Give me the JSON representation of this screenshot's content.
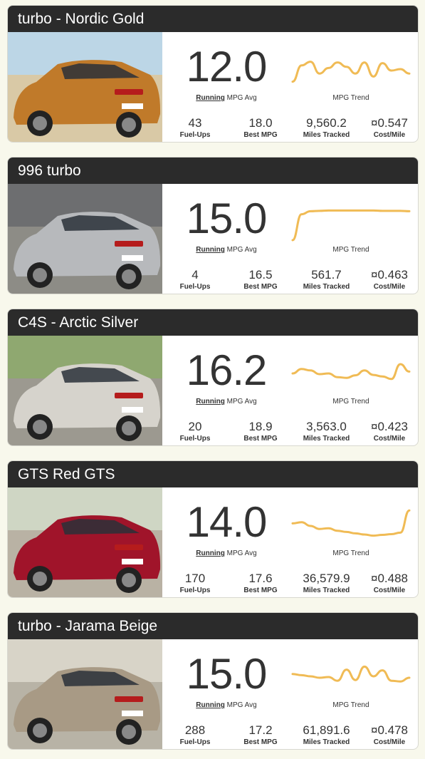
{
  "cars": [
    {
      "name": "turbo - Nordic Gold",
      "mpg": "12.0",
      "running_label": "Running",
      "avg_label": "MPG Avg",
      "trend_label": "MPG Trend",
      "trend": [
        18,
        62,
        72,
        40,
        55,
        70,
        58,
        40,
        70,
        32,
        68,
        48,
        52,
        40
      ],
      "stats": [
        {
          "value": "43",
          "label": "Fuel-Ups"
        },
        {
          "value": "18.0",
          "label": "Best MPG"
        },
        {
          "value": "9,560.2",
          "label": "Miles Tracked"
        },
        {
          "value": "¤0.547",
          "label": "Cost/Mile"
        }
      ],
      "photo": {
        "body": "#c07a2a",
        "sky": "#bcd6e6",
        "ground": "#d9c9a6"
      }
    },
    {
      "name": "996 turbo",
      "mpg": "15.0",
      "running_label": "Running",
      "avg_label": "MPG Avg",
      "trend_label": "MPG Trend",
      "trend": [
        0,
        70,
        78,
        79,
        80,
        80,
        80,
        80,
        80,
        80,
        79,
        79,
        79,
        78
      ],
      "stats": [
        {
          "value": "4",
          "label": "Fuel-Ups"
        },
        {
          "value": "16.5",
          "label": "Best MPG"
        },
        {
          "value": "561.7",
          "label": "Miles Tracked"
        },
        {
          "value": "¤0.463",
          "label": "Cost/Mile"
        }
      ],
      "photo": {
        "body": "#b7b9bc",
        "sky": "#6d6e70",
        "ground": "#8d8c86"
      }
    },
    {
      "name": "C4S - Arctic Silver",
      "mpg": "16.2",
      "running_label": "Running",
      "avg_label": "MPG Avg",
      "trend_label": "MPG Trend",
      "trend": [
        50,
        62,
        58,
        48,
        50,
        40,
        38,
        45,
        58,
        46,
        42,
        35,
        75,
        55
      ],
      "stats": [
        {
          "value": "20",
          "label": "Fuel-Ups"
        },
        {
          "value": "18.9",
          "label": "Best MPG"
        },
        {
          "value": "3,563.0",
          "label": "Miles Tracked"
        },
        {
          "value": "¤0.423",
          "label": "Cost/Mile"
        }
      ],
      "photo": {
        "body": "#d6d3cc",
        "sky": "#8fa870",
        "ground": "#9c9990"
      }
    },
    {
      "name": "GTS Red GTS",
      "mpg": "14.0",
      "running_label": "Running",
      "avg_label": "MPG Avg",
      "trend_label": "MPG Trend",
      "trend": [
        55,
        58,
        48,
        40,
        42,
        35,
        32,
        28,
        25,
        22,
        24,
        26,
        30,
        90
      ],
      "stats": [
        {
          "value": "170",
          "label": "Fuel-Ups"
        },
        {
          "value": "17.6",
          "label": "Best MPG"
        },
        {
          "value": "36,579.9",
          "label": "Miles Tracked"
        },
        {
          "value": "¤0.488",
          "label": "Cost/Mile"
        }
      ],
      "photo": {
        "body": "#a0142a",
        "sky": "#cfd6c4",
        "ground": "#b9b2a4"
      }
    },
    {
      "name": "turbo - Jarama Beige",
      "mpg": "15.0",
      "running_label": "Running",
      "avg_label": "MPG Avg",
      "trend_label": "MPG Trend",
      "trend": [
        58,
        55,
        52,
        48,
        50,
        40,
        70,
        42,
        78,
        52,
        68,
        40,
        38,
        48
      ],
      "stats": [
        {
          "value": "288",
          "label": "Fuel-Ups"
        },
        {
          "value": "17.2",
          "label": "Best MPG"
        },
        {
          "value": "61,891.6",
          "label": "Miles Tracked"
        },
        {
          "value": "¤0.478",
          "label": "Cost/Mile"
        }
      ],
      "photo": {
        "body": "#a89a85",
        "sky": "#d8d4c8",
        "ground": "#b8b3a6"
      }
    }
  ]
}
